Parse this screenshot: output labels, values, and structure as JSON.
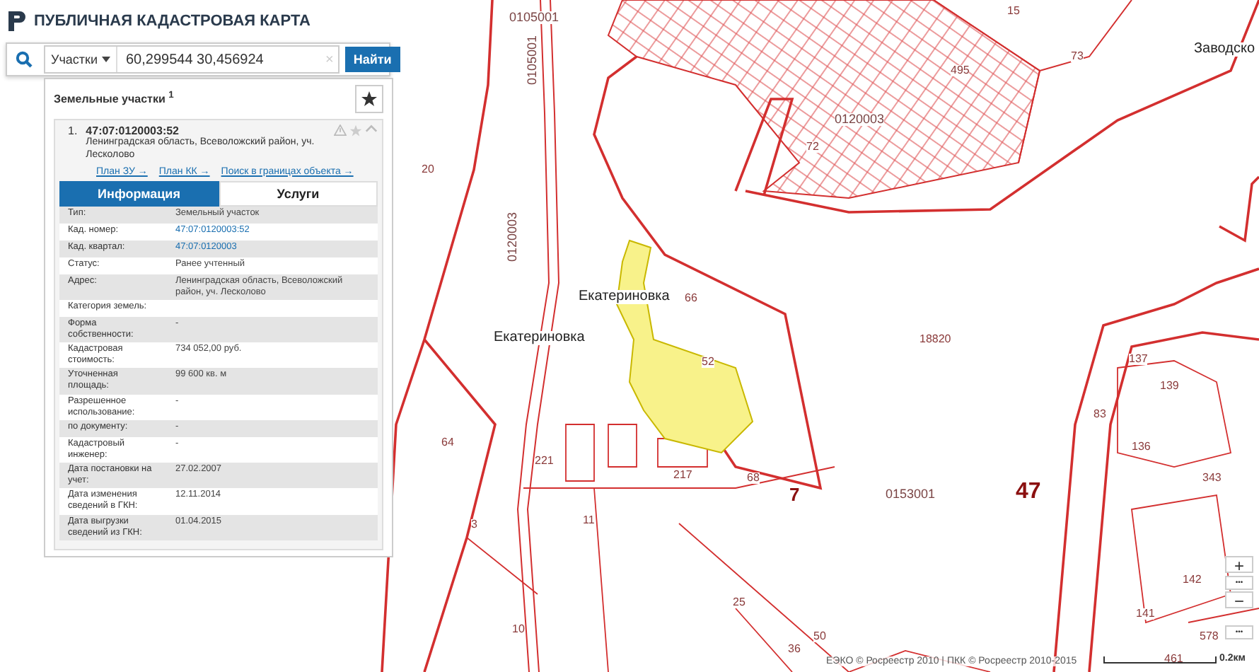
{
  "header": {
    "title": "ПУБЛИЧНАЯ КАДАСТРОВАЯ КАРТА"
  },
  "search": {
    "type_select": "Участки",
    "value": "60,299544 30,456924",
    "clear": "×",
    "button": "Найти"
  },
  "results": {
    "title": "Земельные участки $^{1}$",
    "items": [
      {
        "index": "1.",
        "number": "47:07:0120003:52",
        "address": "Ленинградская область, Всеволожский район, уч. Лесколово",
        "expanded": true,
        "links": [
          "План ЗУ →",
          "План КК →",
          "Поиск в границах объекта →"
        ]
      }
    ]
  },
  "tabs": [
    {
      "label": "Информация",
      "selected": true
    },
    {
      "label": "Услуги",
      "selected": false
    }
  ],
  "info_rows": [
    {
      "label": "Тип:",
      "value": "Земельный участок",
      "kind": "text"
    },
    {
      "label": "Кад. номер:",
      "value": "47:07:0120003:52",
      "kind": "link"
    },
    {
      "label": "Кад. квартал:",
      "value": "47:07:0120003",
      "kind": "link"
    },
    {
      "label": "Статус:",
      "value": "Ранее учтенный",
      "kind": "text"
    },
    {
      "label": "Адрес:",
      "value": "Ленинградская область, Всеволожский район, уч. Лесколово",
      "kind": "text"
    },
    {
      "label": "Категория земель:",
      "kind": "text"
    },
    {
      "label": "Форма собственности:",
      "value": "-",
      "kind": "text"
    },
    {
      "label": "Кадастровая стоимость:",
      "value": "734 052,00 руб.",
      "kind": "text"
    },
    {
      "label": "Уточненная площадь:",
      "value": "99 600 кв. м",
      "kind": "text"
    },
    {
      "label": "Разрешенное использование:",
      "value": "-",
      "kind": "text"
    },
    {
      "label": "по документу:",
      "value": "-",
      "kind": "text"
    },
    {
      "label": "Кадастровый инженер:",
      "value": "-",
      "kind": "text"
    },
    {
      "label": "Дата постановки на учет:",
      "value": "27.02.2007",
      "kind": "text"
    },
    {
      "label": "Дата изменения сведений в ГКН:",
      "value": "12.11.2014",
      "kind": "text"
    },
    {
      "label": "Дата выгрузки сведений из ГКН:",
      "value": "01.04.2015",
      "kind": "text"
    }
  ],
  "map_labels": [
    {
      "text": "Екатериновка",
      "kind": "place"
    },
    {
      "text": "Екатериновка",
      "kind": "place"
    },
    {
      "text": "Заводско",
      "kind": "place"
    },
    {
      "text": "0105001",
      "kind": "quarter"
    },
    {
      "text": "0105001",
      "kind": "quarter"
    },
    {
      "text": "0120003",
      "kind": "quarter"
    },
    {
      "text": "0120003",
      "kind": "quarter"
    },
    {
      "text": "7",
      "kind": "zone"
    },
    {
      "text": "0153001",
      "kind": "quarter"
    },
    {
      "text": "47",
      "kind": "district"
    },
    {
      "text": "72",
      "kind": "parcel"
    },
    {
      "text": "495",
      "kind": "parcel"
    },
    {
      "text": "15",
      "kind": "parcel"
    },
    {
      "text": "73",
      "kind": "parcel"
    },
    {
      "text": "66",
      "kind": "parcel"
    },
    {
      "text": "52",
      "kind": "parcel"
    },
    {
      "text": "18820",
      "kind": "parcel"
    },
    {
      "text": "217",
      "kind": "parcel"
    },
    {
      "text": "68",
      "kind": "parcel"
    },
    {
      "text": "221",
      "kind": "parcel"
    },
    {
      "text": "20",
      "kind": "parcel"
    },
    {
      "text": "64",
      "kind": "parcel"
    },
    {
      "text": "11",
      "kind": "parcel"
    },
    {
      "text": "3",
      "kind": "parcel"
    },
    {
      "text": "25",
      "kind": "parcel"
    },
    {
      "text": "50",
      "kind": "parcel"
    },
    {
      "text": "36",
      "kind": "parcel"
    },
    {
      "text": "10",
      "kind": "parcel"
    },
    {
      "text": "137",
      "kind": "parcel"
    },
    {
      "text": "139",
      "kind": "parcel"
    },
    {
      "text": "83",
      "kind": "parcel"
    },
    {
      "text": "136",
      "kind": "parcel"
    },
    {
      "text": "343",
      "kind": "parcel"
    },
    {
      "text": "142",
      "kind": "parcel"
    },
    {
      "text": "141",
      "kind": "parcel"
    },
    {
      "text": "578",
      "kind": "parcel"
    },
    {
      "text": "461",
      "kind": "parcel"
    }
  ],
  "zoom_controls": [
    "+",
    "•••",
    "−",
    "•••"
  ],
  "scale": "0.2км",
  "attribution": "ЕЭКО © Росреестр 2010 | ПКК © Росреестр 2010-2015"
}
